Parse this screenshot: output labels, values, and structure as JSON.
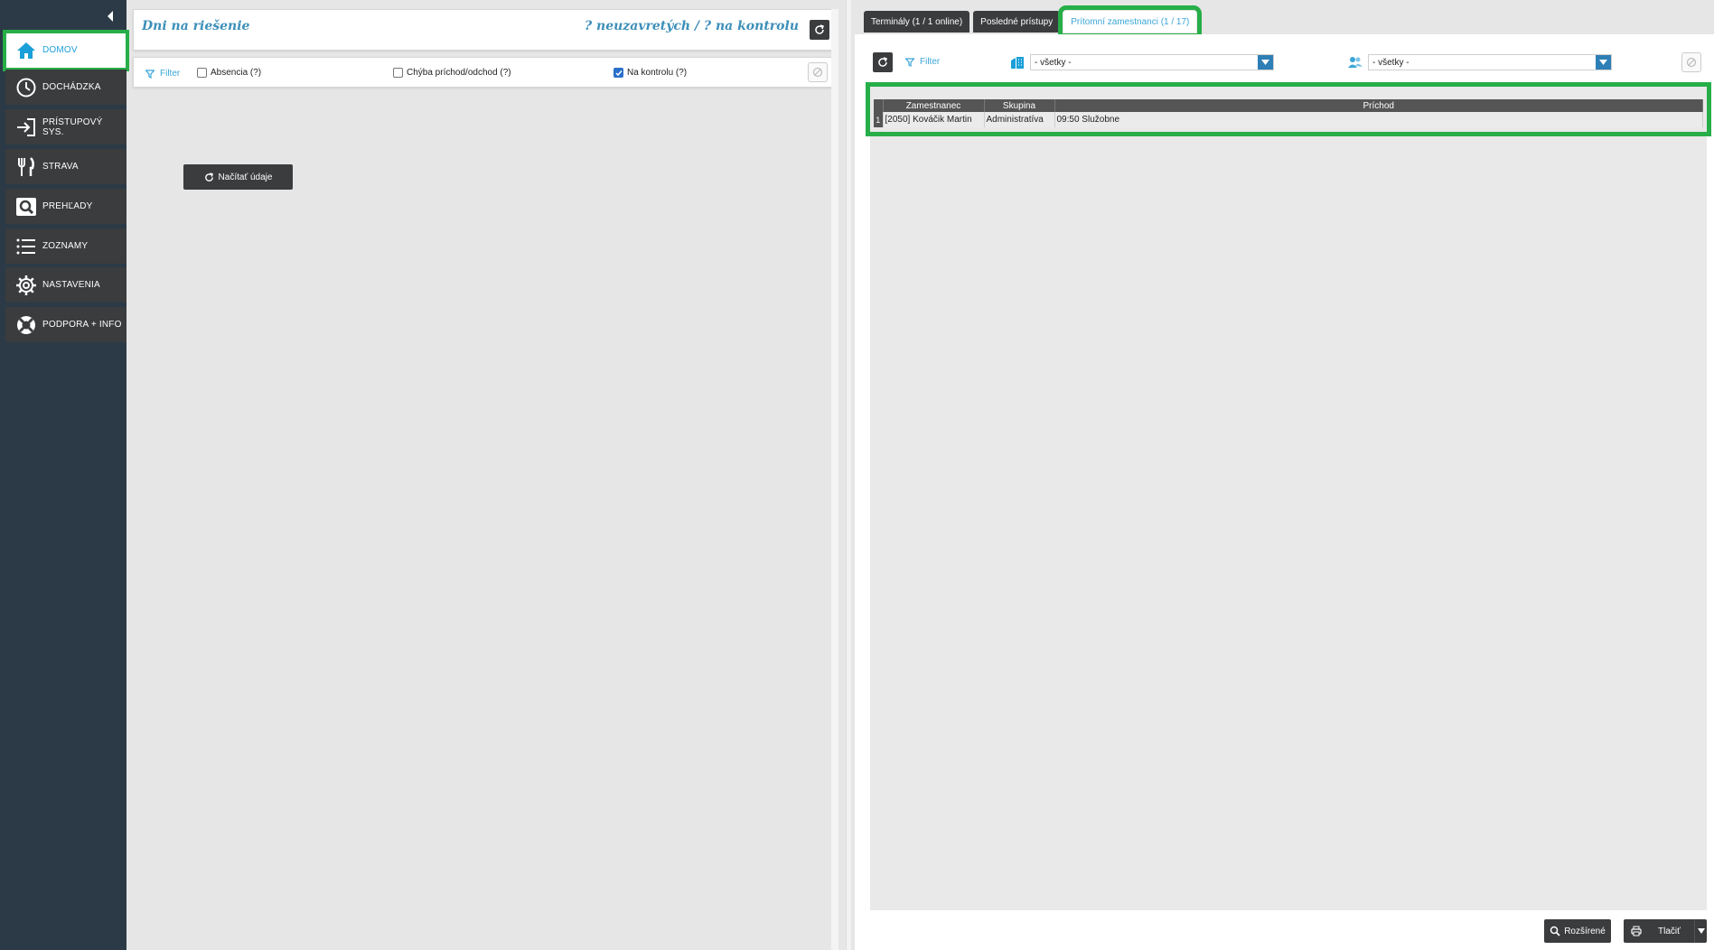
{
  "sidebar": {
    "items": [
      {
        "label": "DOMOV",
        "icon": "home-icon",
        "active": true
      },
      {
        "label": "DOCHÁDZKA",
        "icon": "clock-icon"
      },
      {
        "label": "PRÍSTUPOVÝ SYS.",
        "icon": "sign-in-icon"
      },
      {
        "label": "STRAVA",
        "icon": "fork-knife-icon"
      },
      {
        "label": "PREHĽADY",
        "icon": "magnifier-icon"
      },
      {
        "label": "ZOZNAMY",
        "icon": "list-icon"
      },
      {
        "label": "NASTAVENIA",
        "icon": "gear-icon"
      },
      {
        "label": "PODPORA + INFO",
        "icon": "lifebuoy-icon"
      }
    ]
  },
  "mid": {
    "title": "Dni na riešenie",
    "summary": "? neuzavretých / ? na kontrolu",
    "filter_label": "Filter",
    "checks": [
      {
        "label": "Absencia (?)",
        "checked": false
      },
      {
        "label": "Chýba príchod/odchod (?)",
        "checked": false
      },
      {
        "label": "Na kontrolu (?)",
        "checked": true
      }
    ],
    "load_label": "Načítať údaje"
  },
  "right": {
    "tabs": [
      {
        "label": "Terminály (1 / 1 online)"
      },
      {
        "label": "Posledné prístupy"
      },
      {
        "label": "Prítomní zamestnanci (1 / 17)",
        "active": true
      }
    ],
    "filter_label": "Filter",
    "select1": "- všetky -",
    "select2": "- všetky -",
    "grid": {
      "headers": [
        "Zamestnanec",
        "Skupina",
        "Príchod"
      ],
      "rows": [
        {
          "num": "1",
          "employee": "[2050] Kováčik Martin",
          "group": "Administratíva",
          "arrival": "09:50 Služobne"
        }
      ]
    },
    "btn_extended": "Rozšírené",
    "btn_print": "Tlačiť"
  },
  "colors": {
    "sidebar_bg": "#2b3a46",
    "accent_blue": "#3aa5d8",
    "highlight_green": "#27ae48",
    "dark_button": "#3a3c3e"
  }
}
